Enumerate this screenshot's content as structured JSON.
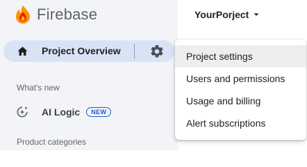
{
  "brand": {
    "name": "Firebase",
    "logo_icon": "firebase-flame-icon"
  },
  "sidebar": {
    "project_overview": {
      "label": "Project Overview",
      "icon": "home-icon"
    },
    "settings_icon": "gear-icon",
    "whats_new_label": "What's new",
    "ai_logic": {
      "label": "AI Logic",
      "badge": "NEW",
      "icon": "ai-logic-icon"
    },
    "product_categories_label": "Product categories"
  },
  "header": {
    "project_name": "YourPorject",
    "dropdown_icon": "caret-down-icon"
  },
  "settings_menu": {
    "items": [
      {
        "label": "Project settings"
      },
      {
        "label": "Users and permissions"
      },
      {
        "label": "Usage and billing"
      },
      {
        "label": "Alert subscriptions"
      }
    ]
  },
  "colors": {
    "active_pill": "#d8e3f6",
    "sidebar_bg": "#f3f4f8",
    "badge_blue": "#1a5fd0",
    "flame_orange": "#ff9100",
    "flame_red": "#dd2c00",
    "flame_yellow": "#ffc400"
  }
}
